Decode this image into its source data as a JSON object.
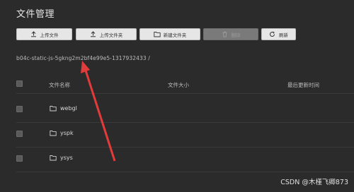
{
  "page_title": "文件管理",
  "toolbar": {
    "upload_file": "上传文件",
    "upload_folder": "上传文件夹",
    "new_folder": "新建文件夹",
    "delete": "删除",
    "refresh": "刷新"
  },
  "path": "b04c-static-js-5gkng2m2bf4e99e5-1317932433 /",
  "table": {
    "headers": [
      "文件名称",
      "文件大小",
      "最后更新时间"
    ],
    "rows": [
      {
        "name": "webgl"
      },
      {
        "name": "yspk"
      },
      {
        "name": "ysys"
      }
    ]
  },
  "watermark": "CSDN @木槿飞卿873",
  "colors": {
    "background": "#2b2b2b",
    "button": "#e6e6e6",
    "button_disabled": "#7a7a7a",
    "annotation_arrow": "#e23b3b"
  }
}
